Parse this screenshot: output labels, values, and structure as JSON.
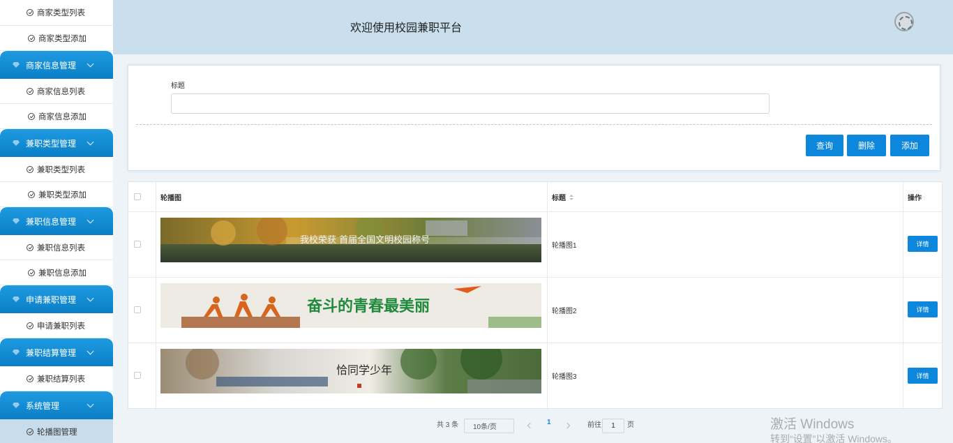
{
  "header": {
    "title": "欢迎使用校园兼职平台",
    "spinner_icon": "loading-icon"
  },
  "sidebar": {
    "items": [
      {
        "type": "sub",
        "label": "商家类型列表"
      },
      {
        "type": "sub",
        "label": "商家类型添加"
      },
      {
        "type": "group",
        "label": "商家信息管理"
      },
      {
        "type": "sub",
        "label": "商家信息列表"
      },
      {
        "type": "sub",
        "label": "商家信息添加"
      },
      {
        "type": "group",
        "label": "兼职类型管理"
      },
      {
        "type": "sub",
        "label": "兼职类型列表"
      },
      {
        "type": "sub",
        "label": "兼职类型添加"
      },
      {
        "type": "group",
        "label": "兼职信息管理"
      },
      {
        "type": "sub",
        "label": "兼职信息列表"
      },
      {
        "type": "sub",
        "label": "兼职信息添加"
      },
      {
        "type": "group",
        "label": "申请兼职管理"
      },
      {
        "type": "sub",
        "label": "申请兼职列表"
      },
      {
        "type": "group",
        "label": "兼职结算管理"
      },
      {
        "type": "sub",
        "label": "兼职结算列表"
      },
      {
        "type": "group",
        "label": "系统管理"
      },
      {
        "type": "sub",
        "label": "轮播图管理",
        "active": true
      }
    ]
  },
  "search": {
    "title_label": "标题",
    "title_value": "",
    "query_button": "查询",
    "delete_button": "删除",
    "add_button": "添加"
  },
  "table": {
    "columns": [
      "轮播图",
      "标题",
      "操作"
    ],
    "rows": [
      {
        "image_text": "我校荣获 首届全国文明校园称号",
        "title": "轮播图1",
        "action": "详情"
      },
      {
        "image_text": "奋斗的青春最美丽",
        "title": "轮播图2",
        "action": "详情"
      },
      {
        "image_text": "恰同学少年",
        "title": "轮播图3",
        "action": "详情"
      }
    ]
  },
  "pagination": {
    "total": "共 3 条",
    "page_size": "10条/页",
    "current": "1",
    "goto_label": "前往",
    "goto_value": "1",
    "page_unit": "页"
  },
  "watermark": {
    "line1": "激活 Windows",
    "line2": "转到“设置”以激活 Windows。"
  },
  "colors": {
    "primary": "#0d87dc",
    "header_bg": "#c9dfee",
    "menu_group": "#1e9ae0"
  }
}
